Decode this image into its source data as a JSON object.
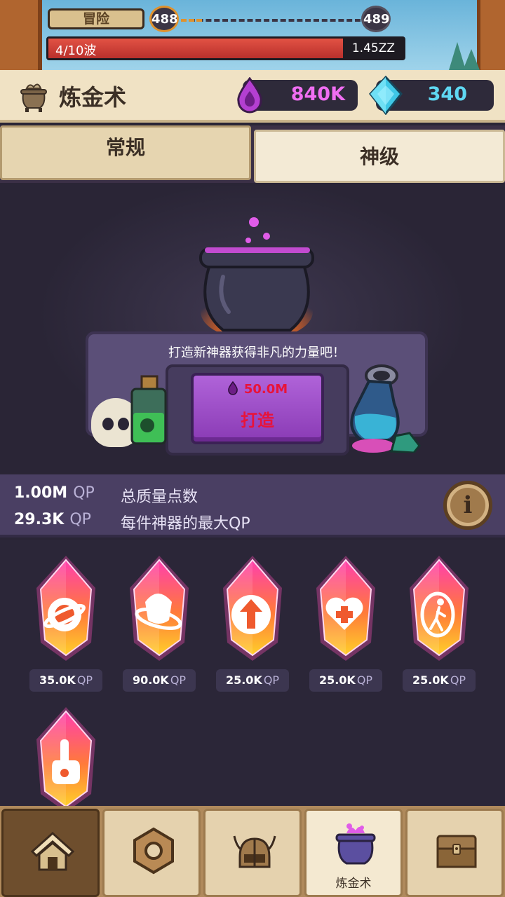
{
  "top": {
    "adventure_label": "冒险",
    "stage_current": "488",
    "stage_next": "489",
    "wave_text": "4/10波",
    "enemy_hp": "1.45ZZ",
    "wave_progress": 0.83
  },
  "header": {
    "title": "炼金术",
    "essence": "840K",
    "gems": "340"
  },
  "tabs": [
    {
      "label": "常规",
      "selected": true
    },
    {
      "label": "神级",
      "selected": false
    }
  ],
  "forge": {
    "message": "打造新神器获得非凡的力量吧！",
    "cost": "50.0M",
    "button_label": "打造"
  },
  "qp": {
    "total_value": "1.00M",
    "total_unit": "QP",
    "total_desc": "总质量点数",
    "max_value": "29.3K",
    "max_unit": "QP",
    "max_desc": "每件神器的最大QP"
  },
  "artifacts": [
    {
      "icon": "planet-icon",
      "price": "35.0K",
      "unit": "QP"
    },
    {
      "icon": "orbit-ring-icon",
      "price": "90.0K",
      "unit": "QP"
    },
    {
      "icon": "arrow-up-icon",
      "price": "25.0K",
      "unit": "QP"
    },
    {
      "icon": "heart-plus-icon",
      "price": "25.0K",
      "unit": "QP"
    },
    {
      "icon": "portal-figure-icon",
      "price": "25.0K",
      "unit": "QP"
    },
    {
      "icon": "hand-finger-icon",
      "price": "",
      "unit": ""
    }
  ],
  "nav": [
    {
      "icon": "home-icon",
      "label": ""
    },
    {
      "icon": "hex-nut-icon",
      "label": ""
    },
    {
      "icon": "viking-helmet-icon",
      "label": ""
    },
    {
      "icon": "cauldron-icon",
      "label": "炼金术"
    },
    {
      "icon": "treasure-chest-icon",
      "label": ""
    }
  ],
  "colors": {
    "essence": "#f06ef2",
    "gems": "#5fd8f2",
    "forge_text": "#e8133a",
    "panel": "#4a3f63"
  }
}
